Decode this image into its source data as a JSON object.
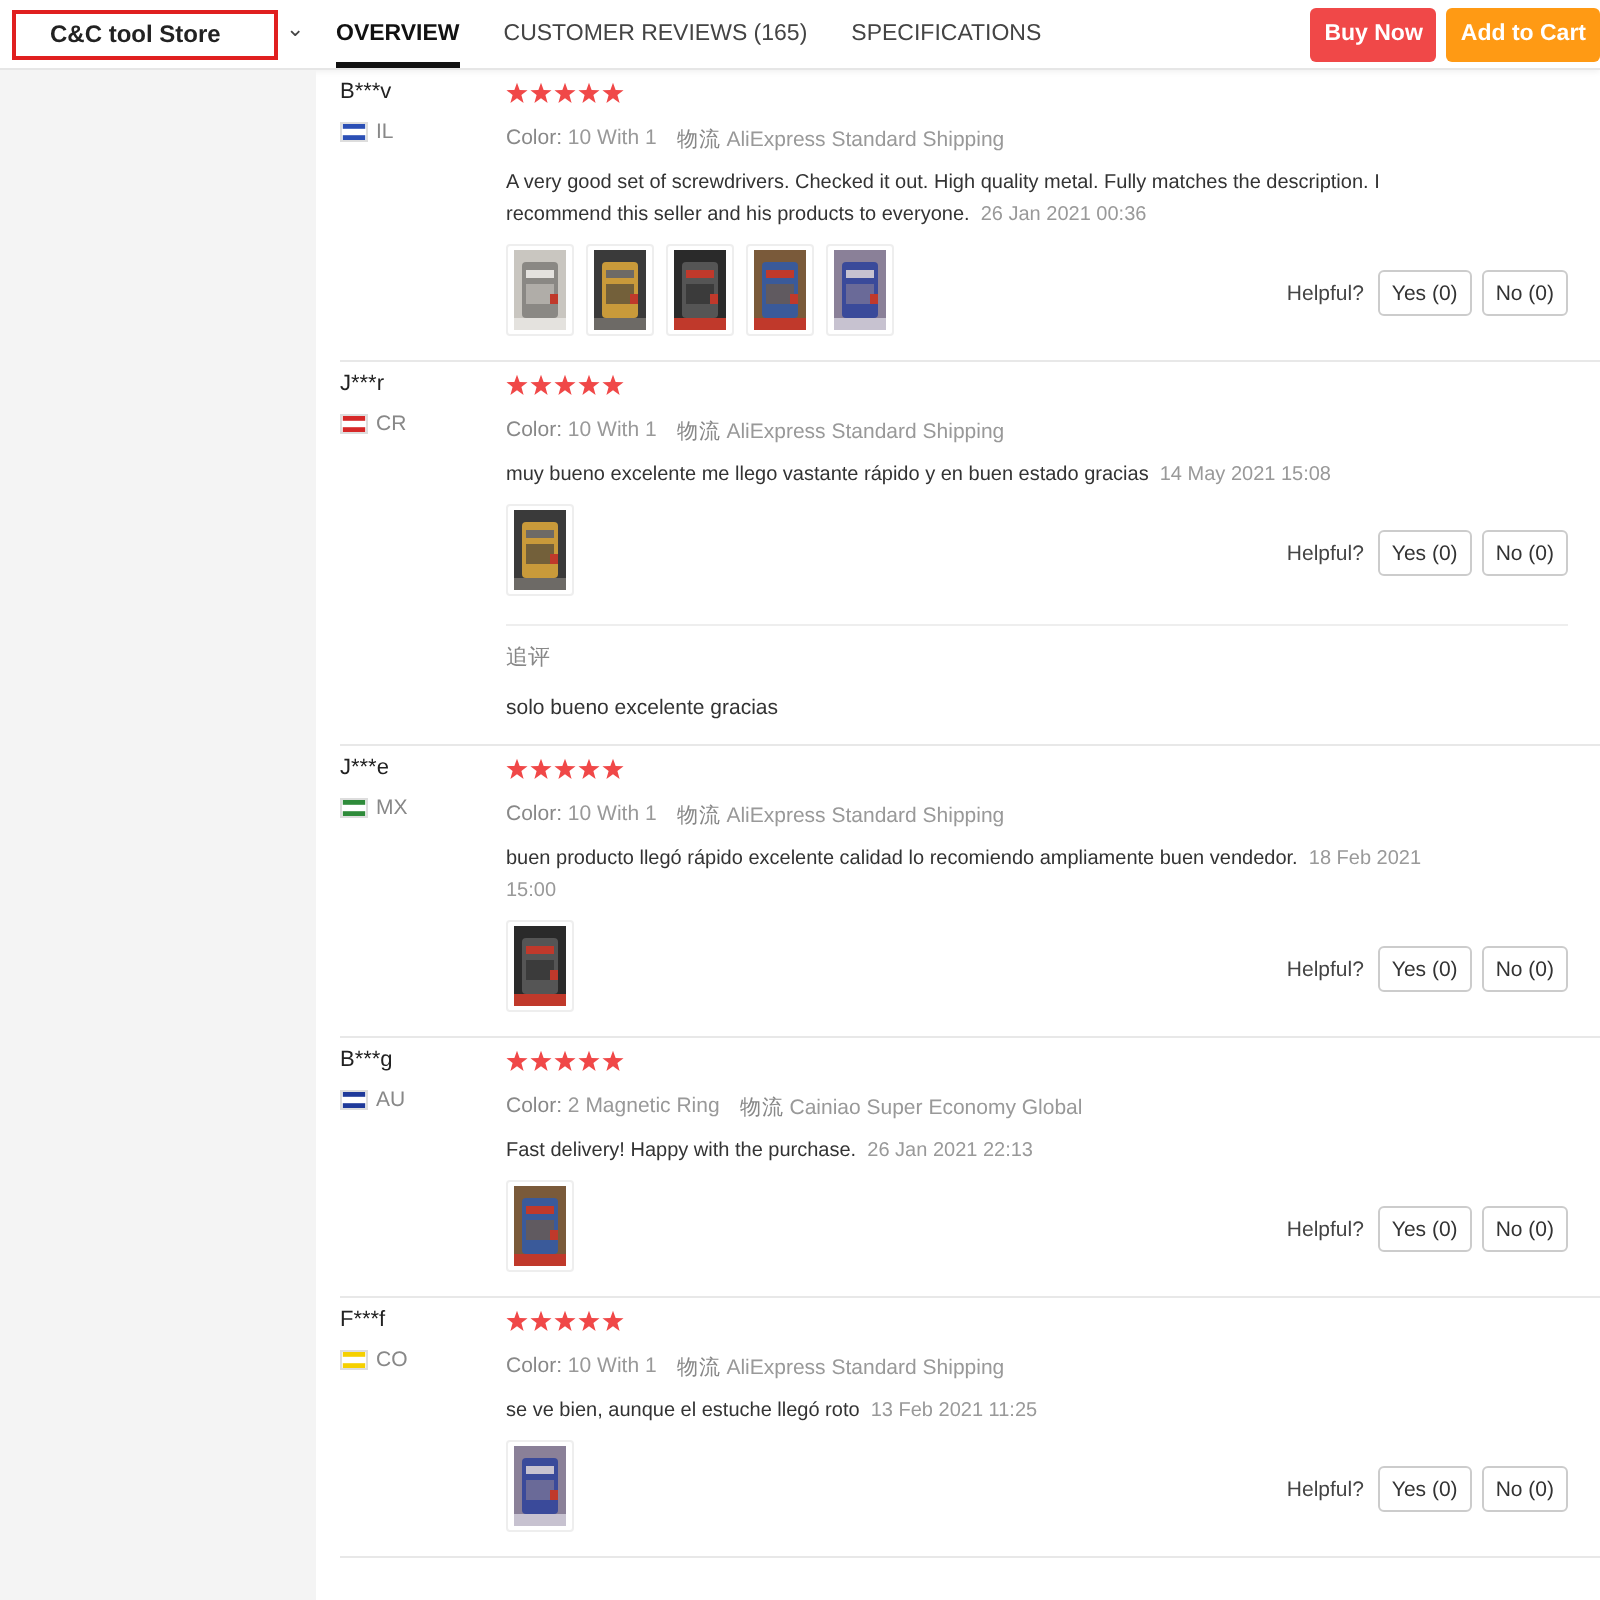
{
  "header": {
    "store": "C&C tool Store",
    "caret": "⌄",
    "tabs": [
      {
        "label": "OVERVIEW",
        "selected": true
      },
      {
        "label": "CUSTOMER REVIEWS (165)",
        "selected": false
      },
      {
        "label": "SPECIFICATIONS",
        "selected": false
      }
    ],
    "buttons": [
      {
        "label": "Buy Now",
        "kind": "buy"
      },
      {
        "label": "Add to Cart",
        "kind": "cart"
      }
    ]
  },
  "reviews": [
    {
      "name": "B***v",
      "country": "IL",
      "color": "#2b4fb5",
      "stars": 5,
      "color_label": "Color:",
      "color_value": "10 With 1",
      "logistics_label": "物流",
      "shipping": "AliExpress Standard Shipping",
      "text": "A very good set of screwdrivers. Checked it out. High quality metal. Fully matches the description. I recommend this seller and his products to everyone.",
      "date": "26 Jan 2021 00:36",
      "photos": [
        {
          "kind": "picture"
        },
        {
          "kind": "picture"
        },
        {
          "kind": "picture"
        },
        {
          "kind": "picture"
        },
        {
          "kind": "picture"
        }
      ],
      "helpful": "Helpful?",
      "yes": "Yes (0)",
      "no": "No (0)"
    },
    {
      "name": "J***r",
      "country": "CR",
      "color": "#d62828",
      "stars": 5,
      "color_label": "Color:",
      "color_value": "10 With 1",
      "logistics_label": "物流",
      "shipping": "AliExpress Standard Shipping",
      "text": "muy bueno excelente me llego vastante rápido y en buen estado gracias",
      "date": "14 May 2021 15:08",
      "photos": [
        {
          "kind": "picture"
        }
      ],
      "helpful": "Helpful?",
      "yes": "Yes (0)",
      "no": "No (0)",
      "followup": {
        "label": "追评",
        "text": "solo bueno excelente gracias"
      }
    },
    {
      "name": "J***e",
      "country": "MX",
      "color": "#2e8b3a",
      "stars": 5,
      "color_label": "Color:",
      "color_value": "10 With 1",
      "logistics_label": "物流",
      "shipping": "AliExpress Standard Shipping",
      "text": "buen producto llegó rápido excelente calidad lo recomiendo ampliamente buen vendedor.",
      "date": "18 Feb 2021 15:00",
      "photos": [
        {
          "kind": "picture"
        }
      ],
      "helpful": "Helpful?",
      "yes": "Yes (0)",
      "no": "No (0)"
    },
    {
      "name": "B***g",
      "country": "AU",
      "color": "#1f3a9a",
      "stars": 5,
      "color_label": "Color:",
      "color_value": "2 Magnetic Ring",
      "logistics_label": "物流",
      "shipping": "Cainiao Super Economy Global",
      "text": "Fast delivery! Happy with the purchase.",
      "date": "26 Jan 2021 22:13",
      "photos": [
        {
          "kind": "picture"
        }
      ],
      "helpful": "Helpful?",
      "yes": "Yes (0)",
      "no": "No (0)"
    },
    {
      "name": "F***f",
      "country": "CO",
      "color": "#f5d000",
      "stars": 5,
      "color_label": "Color:",
      "color_value": "10 With 1",
      "logistics_label": "物流",
      "shipping": "AliExpress Standard Shipping",
      "text": "se ve bien, aunque el estuche llegó roto",
      "date": "13 Feb 2021 11:25",
      "photos": [
        {
          "kind": "picture"
        }
      ],
      "helpful": "Helpful?",
      "yes": "Yes (0)",
      "no": "No (0)"
    }
  ]
}
